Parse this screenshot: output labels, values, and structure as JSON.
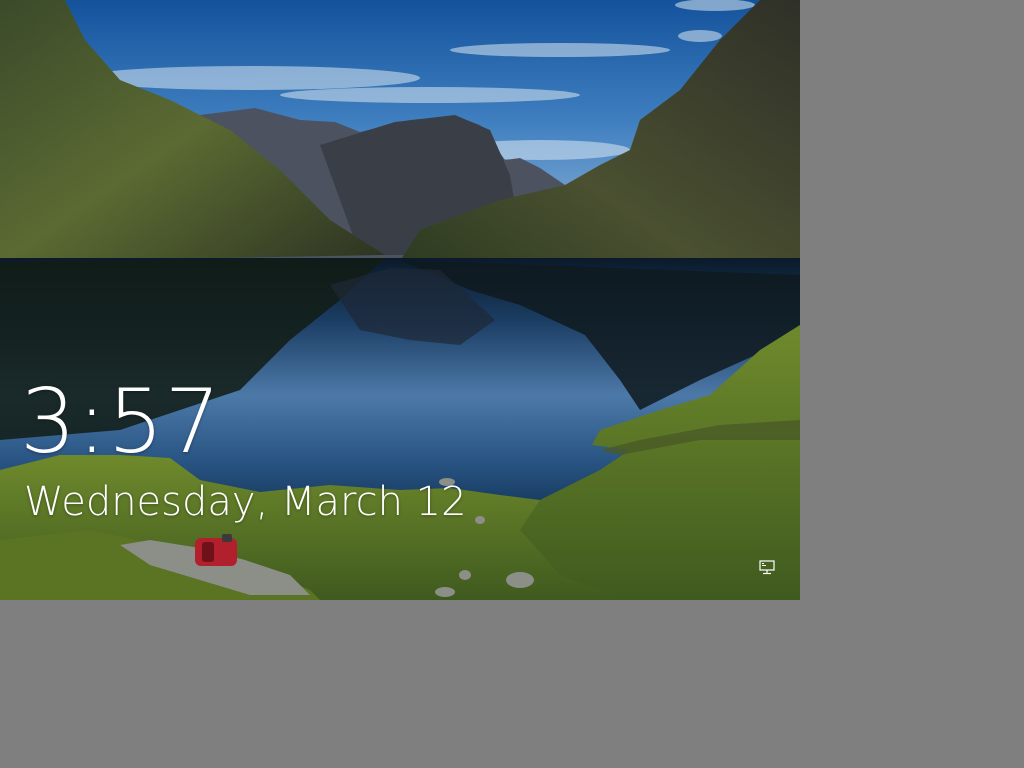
{
  "lock_screen": {
    "time": "3:57",
    "date": "Wednesday, March 12",
    "status_icons": [
      "network-icon"
    ]
  },
  "desktop_background_color": "#7f7f7f"
}
